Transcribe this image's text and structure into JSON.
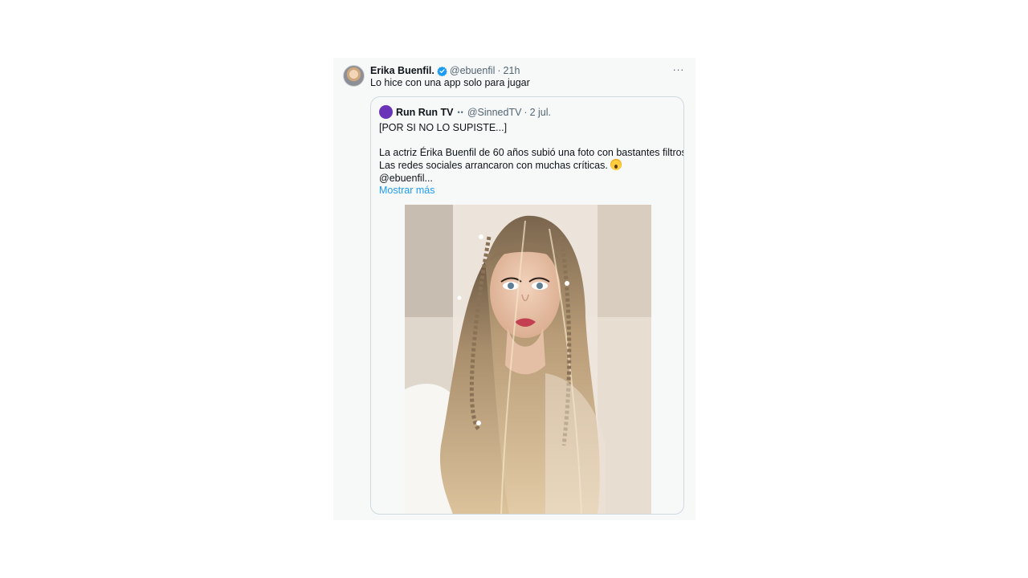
{
  "tweet": {
    "author_name": "Erika Buenfil.",
    "handle": "@ebuenfil",
    "separator": "·",
    "time": "21h",
    "more_glyph": "···",
    "text": "Lo hice con una app solo para jugar",
    "verified_color": "#1d9bf0"
  },
  "quote": {
    "author_name": "Run Run TV",
    "badge": "••",
    "handle": "@SinnedTV",
    "separator": "·",
    "date": "2 jul.",
    "line1": "[POR SI NO LO SUPISTE...]",
    "line2": "La actriz Érika Buenfil de 60 años subió una foto con bastantes filtros.",
    "line3": "Las redes sociales arrancaron con muchas críticas.",
    "line4": "@ebuenfil...",
    "show_more": "Mostrar más",
    "avatar_color": "#6b34b8"
  },
  "colors": {
    "link": "#1d9bf0",
    "text_primary": "#0f1419",
    "text_secondary": "#536471",
    "card_bg": "#f7f9f9",
    "border": "#cfd9de"
  }
}
